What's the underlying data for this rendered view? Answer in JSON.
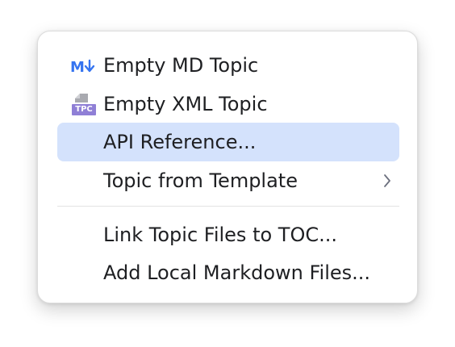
{
  "menu": {
    "items": [
      {
        "label": "Empty MD Topic",
        "icon": "markdown-icon"
      },
      {
        "label": "Empty XML Topic",
        "icon": "tpc-file-icon",
        "icon_text": "TPC"
      },
      {
        "label": "API Reference..."
      },
      {
        "label": "Topic from Template",
        "submenu": "chevron-right-icon"
      },
      {
        "label": "Link Topic Files to TOC..."
      },
      {
        "label": "Add Local Markdown Files..."
      }
    ],
    "selected_index": 2
  },
  "colors": {
    "selection": "#d4e2fc",
    "markdown_icon": "#3574f0",
    "tpc_icon": "#7b68c8",
    "text": "#1e1f22"
  }
}
